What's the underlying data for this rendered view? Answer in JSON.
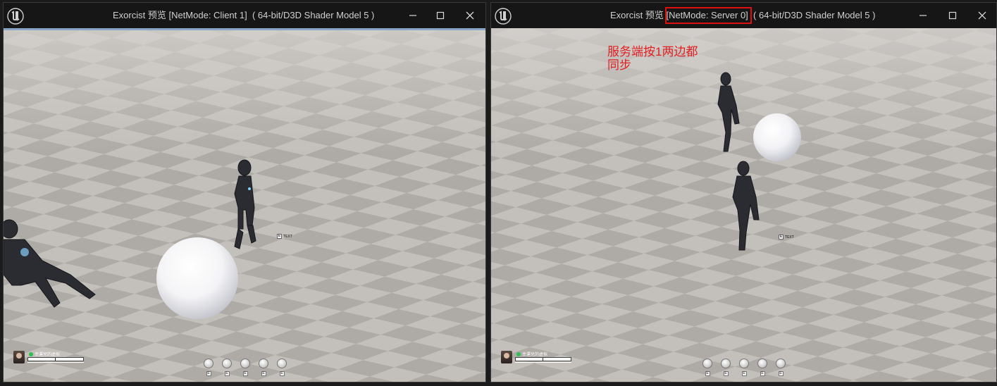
{
  "windows": [
    {
      "id": "client",
      "title_parts": [
        "Exorcist 预览 [NetMode: Client 1]  ( 64-bit/D3D Shader Model 5 )"
      ],
      "highlight_part": null,
      "annotation": null,
      "text_label": "TEXT",
      "player": {
        "name": "幸運兒的虚拟"
      },
      "skill_keys": [
        "E",
        "E",
        "E",
        "E",
        "E"
      ]
    },
    {
      "id": "server",
      "title_parts": [
        "Exorcist 预览 [",
        "NetMode: Server 0]",
        "  ( 64-bit/D3D Shader Model 5 )"
      ],
      "highlight_part": 1,
      "annotation": "服务端按1两边都\n同步",
      "text_label": "TEXT",
      "player": {
        "name": "幸運兒的虚拟"
      },
      "skill_keys": [
        "E",
        "E",
        "E",
        "E",
        "E"
      ]
    }
  ],
  "colors": {
    "annotation": "#e02020",
    "highlight_box": "#e01010",
    "floor_light": "#c4c0bc",
    "floor_dark": "#a9a5a1"
  },
  "icons": {
    "logo": "unreal-logo-icon",
    "minimize": "minimize-icon",
    "maximize": "maximize-icon",
    "close": "close-icon"
  }
}
